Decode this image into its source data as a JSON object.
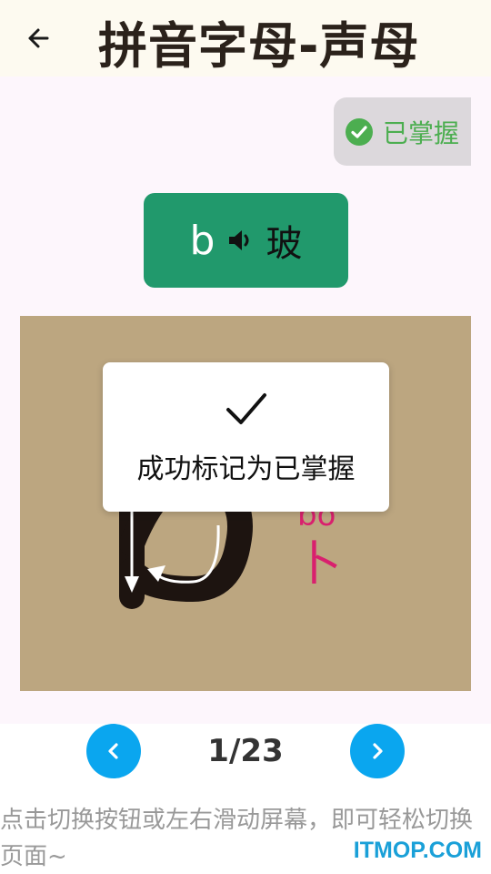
{
  "header": {
    "back_icon": "arrow-left-icon",
    "title": "拼音字母-声母"
  },
  "mastered_badge": {
    "icon": "check-circle-icon",
    "label": "已掌握",
    "color": "#4cae50"
  },
  "letter_button": {
    "letter": "b",
    "speaker_icon": "speaker-icon",
    "example_char": "玻",
    "color": "#21996c"
  },
  "stroke_card": {
    "background": "#bca680",
    "annotation": "bō",
    "stroke_guide_char": "卜"
  },
  "toast": {
    "icon": "checkmark-icon",
    "message": "成功标记为已掌握"
  },
  "pagination": {
    "current": "1",
    "total": "23",
    "label": "1/23",
    "prev_icon": "chevron-left-icon",
    "next_icon": "chevron-right-icon",
    "color": "#0aa6ef"
  },
  "hint": {
    "text": "点击切换按钮或左右滑动屏幕，即可轻松切换页面~"
  },
  "watermark": {
    "text": "ITMOP.COM"
  }
}
